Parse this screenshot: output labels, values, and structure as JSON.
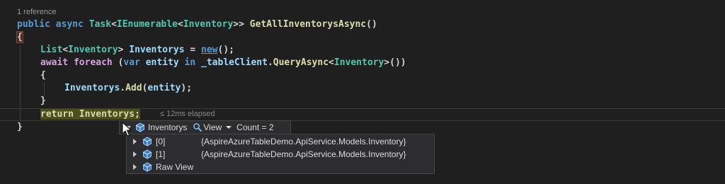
{
  "codelens": "1 reference",
  "code": {
    "sig_public": "public",
    "sig_async": "async",
    "sig_task": "Task",
    "sig_lt1": "<",
    "sig_ienumerable": "IEnumerable",
    "sig_lt2": "<",
    "sig_inventory": "Inventory",
    "sig_gt": ">>",
    "sig_method": "GetAllInventorysAsync",
    "sig_parens": "()",
    "open_brace": "{",
    "l1_list": "List",
    "l1_lt": "<",
    "l1_inventory": "Inventory",
    "l1_gt": ">",
    "l1_var": "Inventorys",
    "l1_eq": "=",
    "l1_new": "new",
    "l1_end": "();",
    "l2_await": "await",
    "l2_foreach": "foreach",
    "l2_paren": "(",
    "l2_var": "var",
    "l2_entity": "entity",
    "l2_in": "in",
    "l2_client": "_tableClient",
    "l2_dot": ".",
    "l2_query": "QueryAsync",
    "l2_lt": "<",
    "l2_inventory": "Inventory",
    "l2_end": ">())",
    "l3_open": "{",
    "l4_var": "Inventorys",
    "l4_dot": ".",
    "l4_add": "Add",
    "l4_p1": "(",
    "l4_entity": "entity",
    "l4_end": ");",
    "l5_close": "}",
    "l6_return": "return",
    "l6_var": "Inventorys",
    "l6_semi": ";",
    "close_brace": "}"
  },
  "elapsed": "≤ 12ms elapsed",
  "datatip": {
    "name": "Inventorys",
    "view_label": "View",
    "value": "Count = 2",
    "items": [
      {
        "name": "[0]",
        "value": "{AspireAzureTableDemo.ApiService.Models.Inventory}"
      },
      {
        "name": "[1]",
        "value": "{AspireAzureTableDemo.ApiService.Models.Inventory}"
      }
    ],
    "raw_view": "Raw View"
  },
  "colors": {
    "background": "#1f1f1f",
    "keyword": "#569cd6",
    "type": "#4ec9b0",
    "method": "#dcdcaa",
    "variable": "#9cdcfe",
    "statement_highlight": "#4b4f1d"
  },
  "icons": [
    "object-icon",
    "view-icon",
    "expand-triangle-icon",
    "collapse-triangle-icon",
    "mouse-pointer-icon",
    "dropdown-caret-icon"
  ]
}
